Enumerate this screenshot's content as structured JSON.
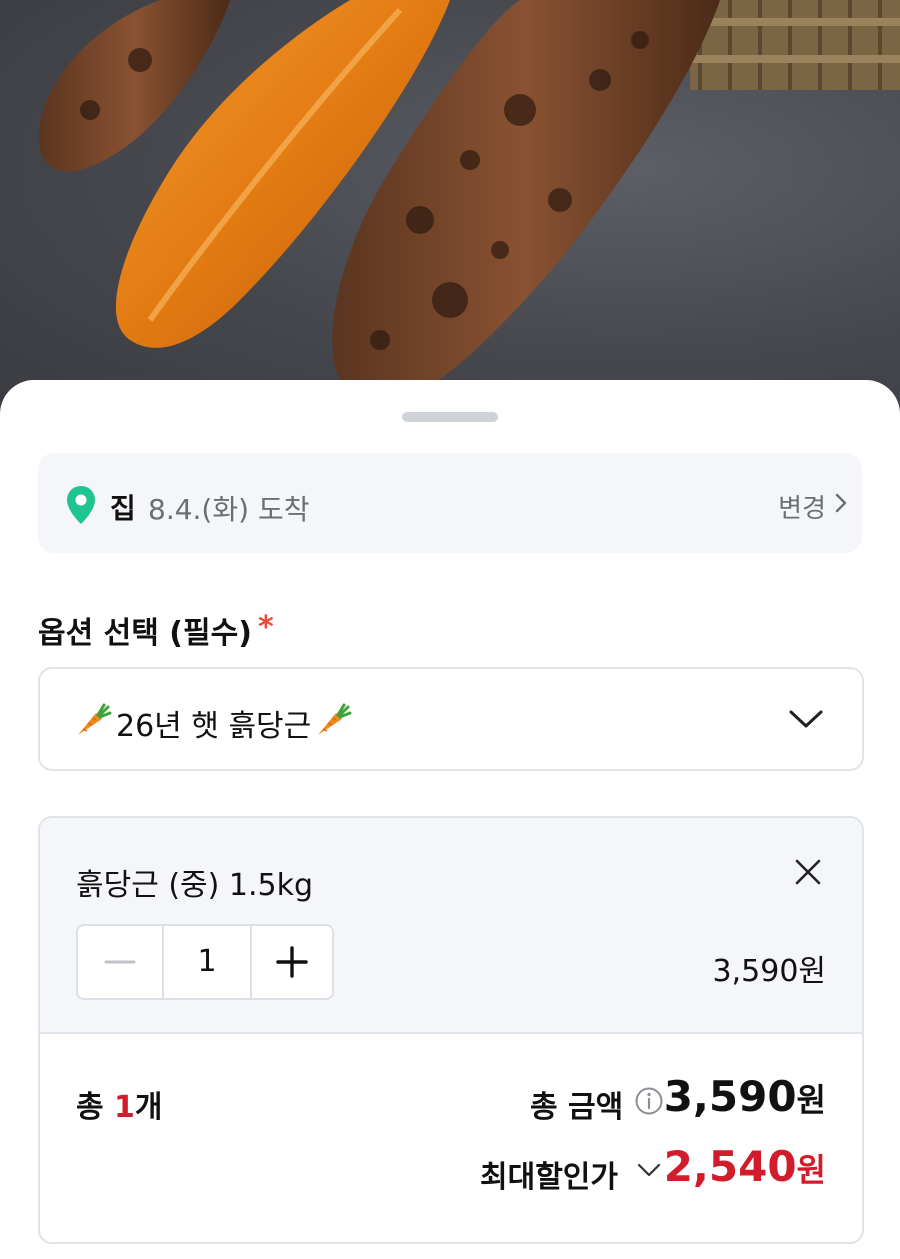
{
  "delivery": {
    "place": "집",
    "date": "8.4.(화) 도착",
    "change_label": "변경"
  },
  "option": {
    "title": "옵션 선택 (필수)",
    "required_mark": "*",
    "selected": "26년 햇 흙당근"
  },
  "item": {
    "name": "흙당근 (중) 1.5kg",
    "quantity": "1",
    "price": "3,590원"
  },
  "summary": {
    "count_prefix": "총 ",
    "count_value": "1",
    "count_suffix": "개",
    "total_label": "총 금액",
    "total_amount_num": "3,590",
    "total_amount_unit": "원",
    "discount_label": "최대할인가",
    "discount_amount_num": "2,540",
    "discount_amount_unit": "원"
  },
  "colors": {
    "accent_red": "#d01c2b",
    "pin_green": "#1fc58e",
    "required_red": "#e84a3c"
  }
}
